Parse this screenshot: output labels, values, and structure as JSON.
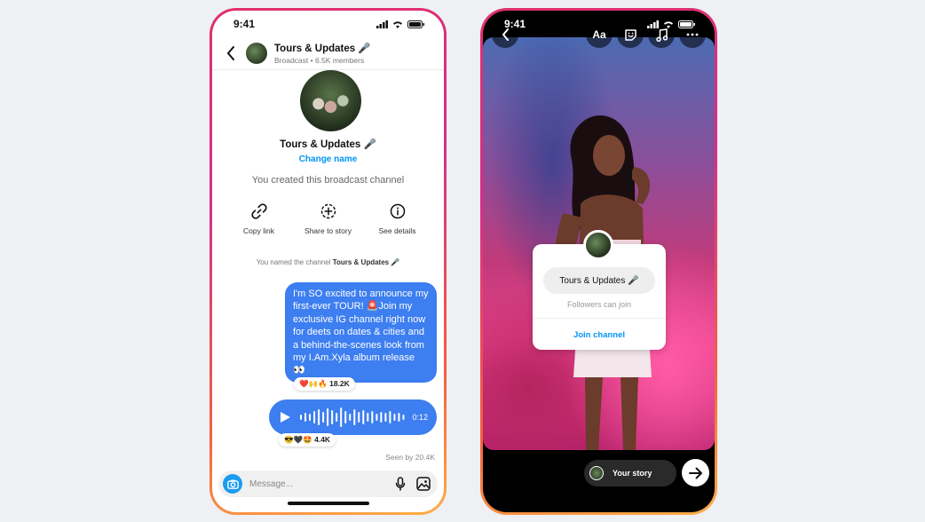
{
  "left_phone": {
    "status_time": "9:41",
    "header": {
      "title": "Tours & Updates 🎤",
      "subtitle": "Broadcast • 6.5K members"
    },
    "channel_name": "Tours & Updates 🎤",
    "change_name": "Change name",
    "created_note": "You created this broadcast channel",
    "actions": [
      {
        "label": "Copy link",
        "icon": "link-icon"
      },
      {
        "label": "Share to story",
        "icon": "add-story-icon"
      },
      {
        "label": "See details",
        "icon": "info-icon"
      }
    ],
    "named_note_prefix": "You named the channel",
    "named_note_channel": "Tours & Updates 🎤",
    "message_text": "I'm SO excited to announce my first-ever TOUR! 🚨Join my exclusive IG channel right now for deets on dates & cities and a behind-the-scenes look from my I.Am.Xyla album release 👀",
    "message_reactions": "❤️🙌🔥 18.2K",
    "voice_duration": "0:12",
    "voice_reactions": "😎🖤🤩 4.4K",
    "seen_by": "Seen by 20.4K",
    "compose_placeholder": "Message..."
  },
  "right_phone": {
    "status_time": "9:41",
    "tools": [
      {
        "label": "",
        "icon": "back-icon"
      },
      {
        "label": "Aa",
        "icon": "text-tool-icon"
      },
      {
        "label": "",
        "icon": "sticker-icon"
      },
      {
        "label": "",
        "icon": "music-icon"
      },
      {
        "label": "",
        "icon": "more-icon"
      }
    ],
    "sticker": {
      "channel_name": "Tours & Updates 🎤",
      "followers_note": "Followers can join",
      "join_label": "Join channel"
    },
    "your_story_label": "Your story"
  },
  "colors": {
    "accent_blue": "#0095f6",
    "bubble_blue": "#3d7ef0",
    "border_gradient": [
      "#e1306c",
      "#f56040",
      "#fcaf45"
    ]
  }
}
